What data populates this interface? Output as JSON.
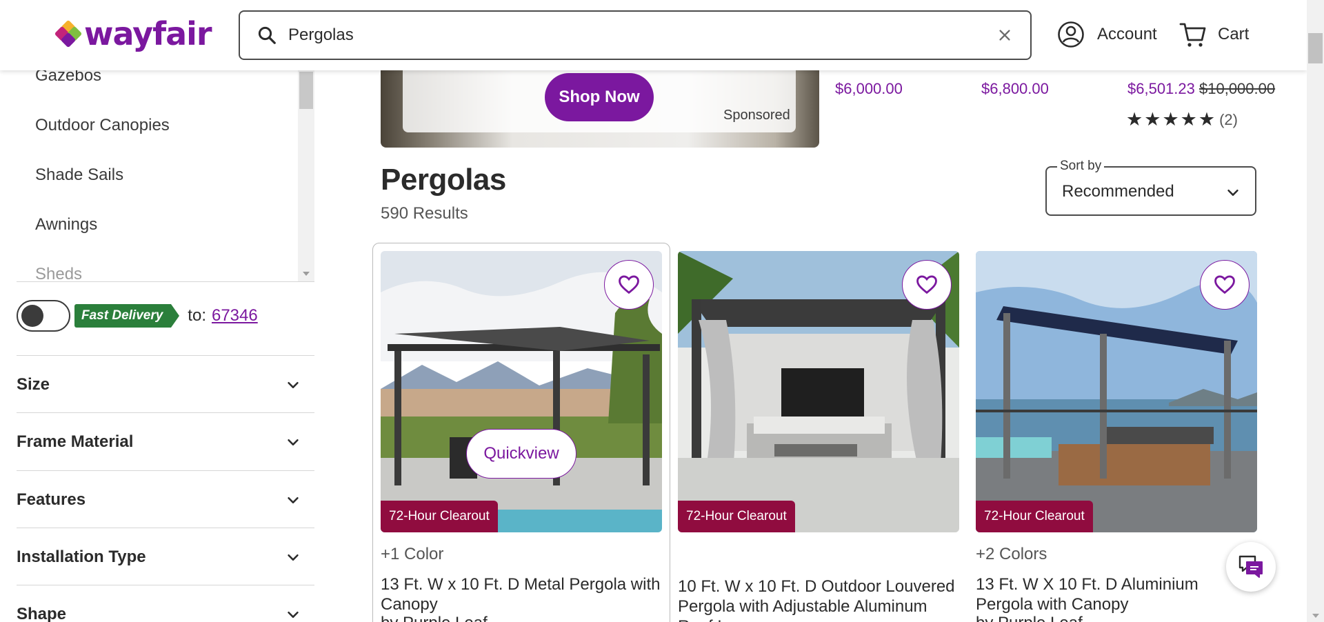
{
  "header": {
    "logo_text": "wayfair",
    "search_value": "Pergolas",
    "account_label": "Account",
    "cart_label": "Cart"
  },
  "sidebar": {
    "categories": [
      "Gazebos",
      "Outdoor Canopies",
      "Shade Sails",
      "Awnings",
      "Sheds"
    ],
    "delivery": {
      "badge": "Fast Delivery",
      "to_label": "to:",
      "zip": "67346",
      "toggle_on": false
    },
    "filters": [
      "Size",
      "Frame Material",
      "Features",
      "Installation Type",
      "Shape"
    ]
  },
  "promo": {
    "button": "Shop Now",
    "sponsored": "Sponsored",
    "prices": [
      "$6,000.00",
      "$6,800.00",
      "$6,501.23"
    ],
    "strike_price": "$10,000.00",
    "rating_count": "(2)",
    "rating_stars": 5
  },
  "listing": {
    "title": "Pergolas",
    "results": "590 Results",
    "sort_label": "Sort by",
    "sort_value": "Recommended"
  },
  "products": [
    {
      "badge": "72-Hour Clearout",
      "colors": "+1 Color",
      "title": "13 Ft. W x 10 Ft. D Metal Pergola with Canopy",
      "by": "by Purple Leaf",
      "quickview": "Quickview"
    },
    {
      "badge": "72-Hour Clearout",
      "colors": "",
      "title": "10 Ft. W x 10 Ft. D Outdoor Louvered Pergola with Adjustable Aluminum Roof Louvers",
      "by": ""
    },
    {
      "badge": "72-Hour Clearout",
      "colors": "+2 Colors",
      "title": "13 Ft. W X 10 Ft. D Aluminium Pergola with Canopy",
      "by": "by Purple Leaf"
    }
  ],
  "colors": {
    "brand_purple": "#7b189f",
    "clearout_badge": "#900c3f",
    "fast_delivery_green": "#2b7f3b"
  },
  "icons": [
    "search-icon",
    "clear-search-icon",
    "account-icon",
    "cart-icon",
    "chevron-down-icon",
    "heart-icon",
    "chat-icon",
    "star-icon"
  ]
}
